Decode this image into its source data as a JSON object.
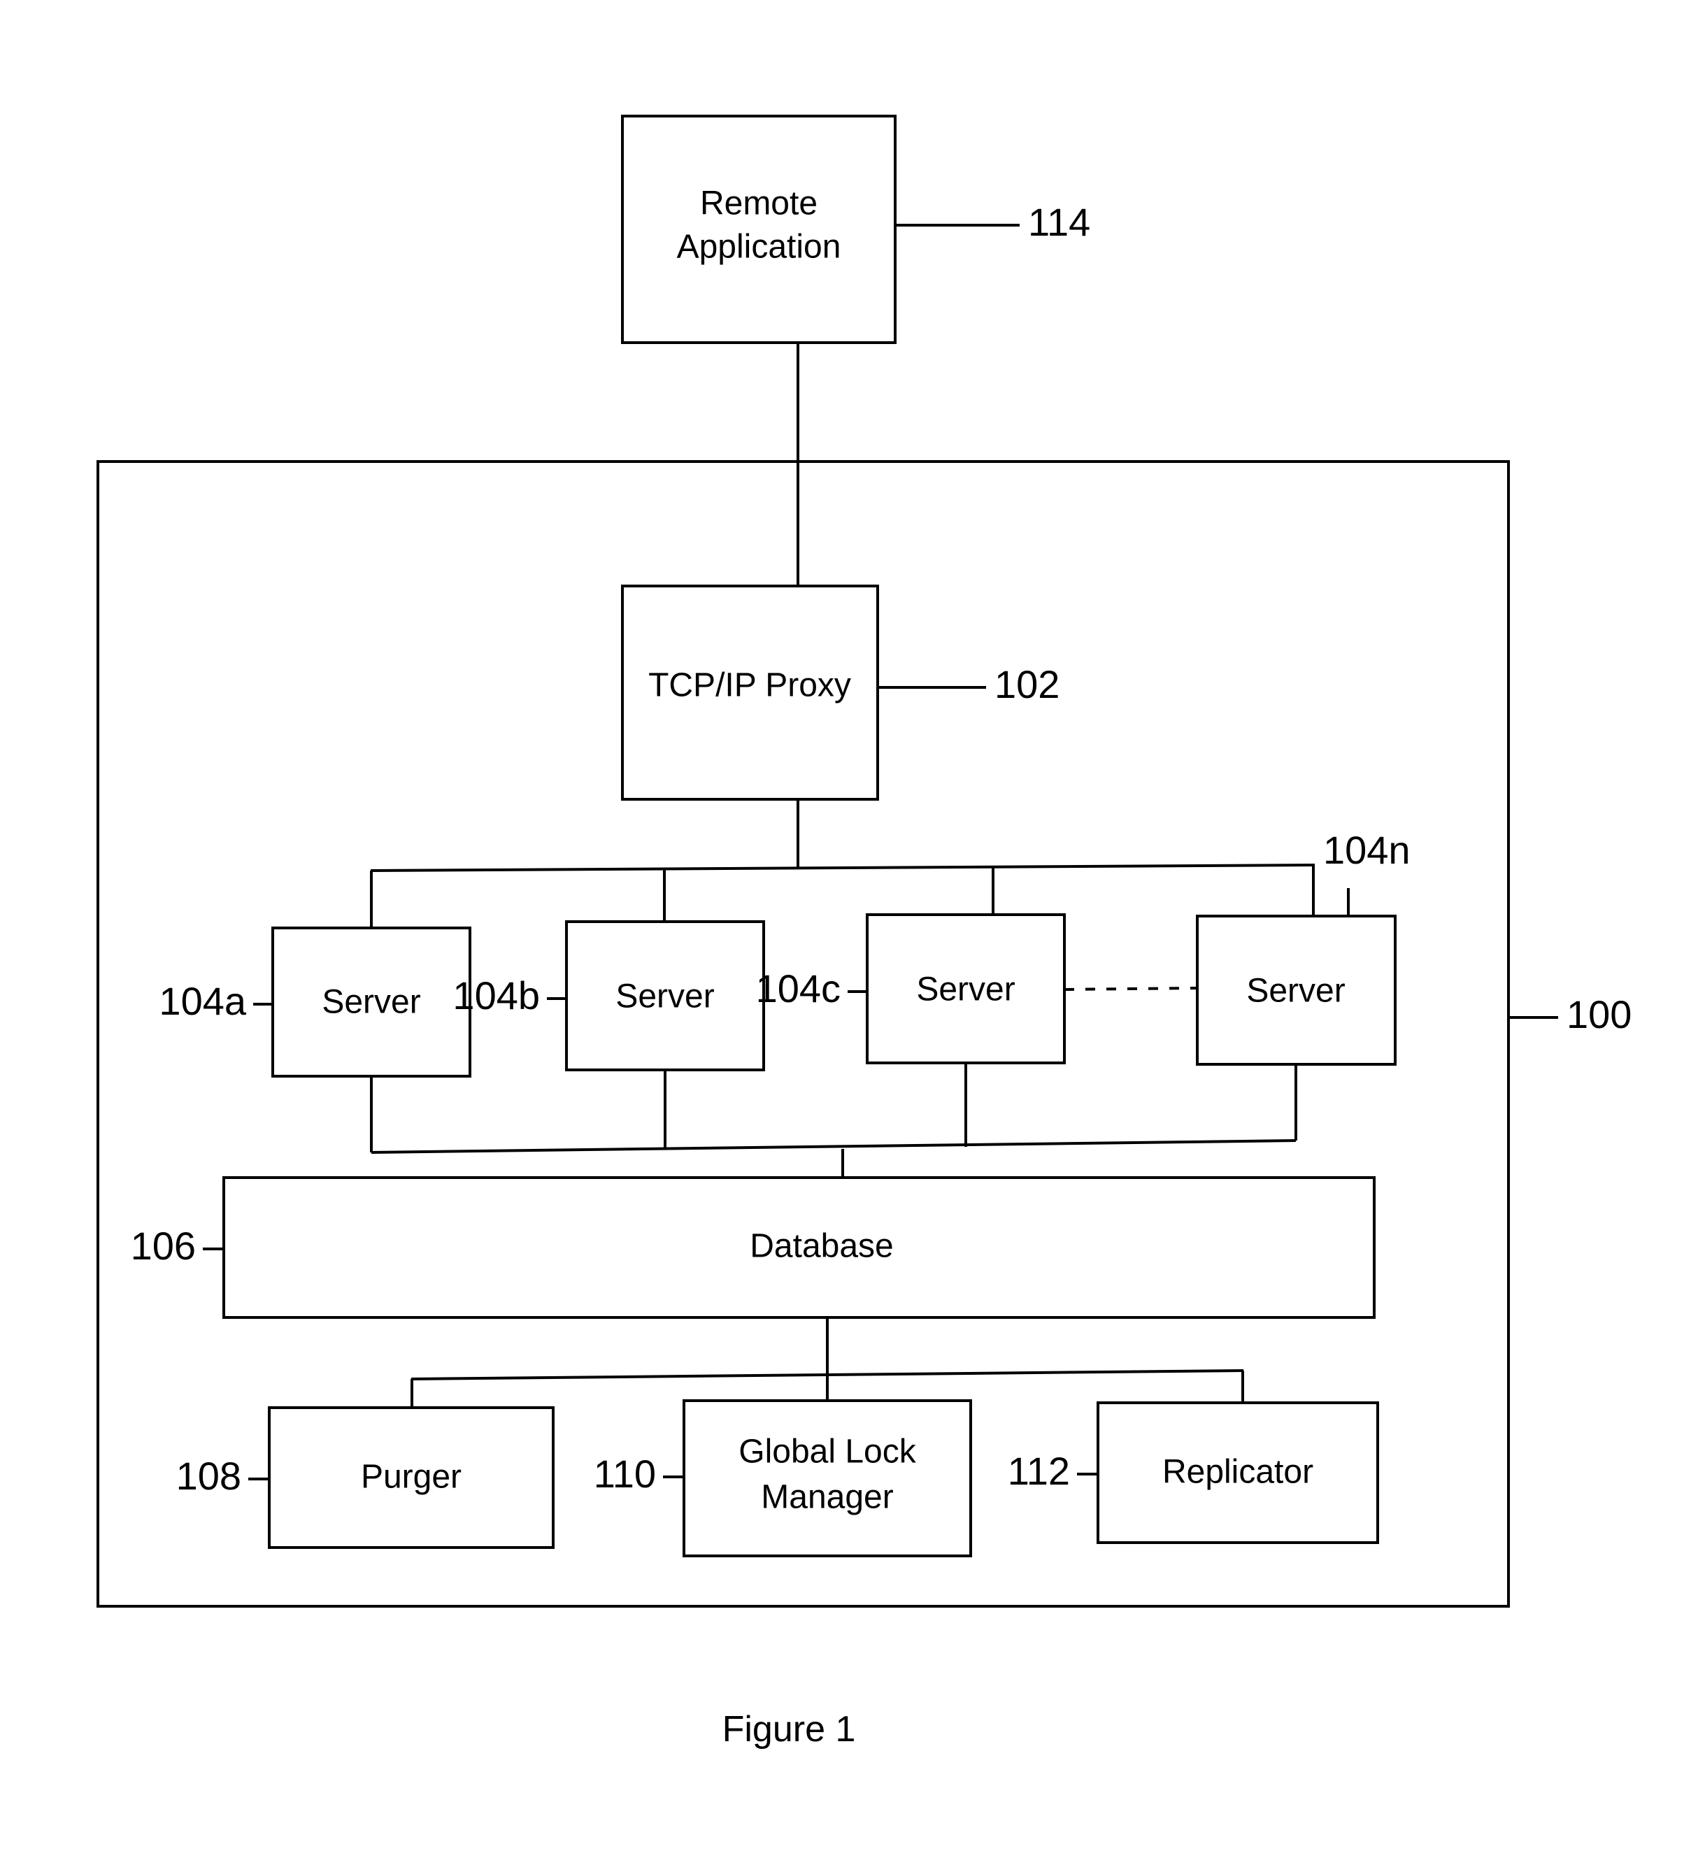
{
  "figure": {
    "caption": "Figure 1"
  },
  "system": {
    "boundary_ref": "100"
  },
  "nodes": {
    "remote_application": {
      "label_line1": "Remote",
      "label_line2": "Application",
      "ref": "114"
    },
    "tcp_ip_proxy": {
      "label": "TCP/IP Proxy",
      "ref": "102"
    },
    "server_a": {
      "label": "Server",
      "ref": "104a"
    },
    "server_b": {
      "label": "Server",
      "ref": "104b"
    },
    "server_c": {
      "label": "Server",
      "ref": "104c"
    },
    "server_n": {
      "label": "Server",
      "ref": "104n"
    },
    "database": {
      "label": "Database",
      "ref": "106"
    },
    "purger": {
      "label": "Purger",
      "ref": "108"
    },
    "global_lock_manager": {
      "label_line1": "Global Lock",
      "label_line2": "Manager",
      "ref": "110"
    },
    "replicator": {
      "label": "Replicator",
      "ref": "112"
    }
  },
  "colors": {
    "ink": "#000000",
    "paper": "#ffffff"
  }
}
